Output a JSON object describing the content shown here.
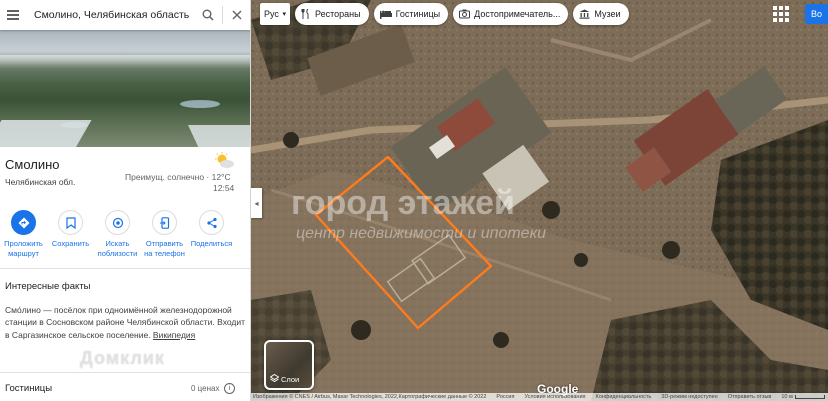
{
  "search": {
    "value": "Смолино, Челябинская область"
  },
  "place": {
    "title": "Смолино",
    "subtitle": "Челябинская обл.",
    "weather": "Преимущ. солнечно · 12°C",
    "time": "12:54"
  },
  "actions": [
    {
      "label_line1": "Проложить",
      "label_line2": "маршрут",
      "icon": "directions-icon"
    },
    {
      "label_line1": "Сохранить",
      "label_line2": "",
      "icon": "bookmark-icon"
    },
    {
      "label_line1": "Искать",
      "label_line2": "поблизости",
      "icon": "nearby-icon"
    },
    {
      "label_line1": "Отправить",
      "label_line2": "на телефон",
      "icon": "send-to-phone-icon"
    },
    {
      "label_line1": "Поделиться",
      "label_line2": "",
      "icon": "share-icon"
    }
  ],
  "facts": {
    "title": "Интересные факты",
    "text": "Смо́лино — посёлок при одноимённой железнодорожной станции в Сосновском районе Челябинской области. Входит в Саргазинское сельское поселение.",
    "link": "Википедия"
  },
  "watermark_domclick": "Домклик",
  "hotels": {
    "title": "Гостиницы",
    "price": "0 ценах"
  },
  "map": {
    "lang": "Рус",
    "chips": [
      {
        "label": "Рестораны",
        "icon": "fork-knife-icon"
      },
      {
        "label": "Гостиницы",
        "icon": "bed-icon"
      },
      {
        "label": "Достопримечатель...",
        "icon": "camera-icon"
      },
      {
        "label": "Музеи",
        "icon": "museum-icon"
      }
    ],
    "signin": "Во",
    "watermark_title": "город этажей",
    "watermark_sub": "центр недвижимости и ипотеки",
    "layers_label": "Слои",
    "google": "Google",
    "attribution": "Изображения © CNES / Airbus, Maxar Technologies, 2022,Картографические данные © 2022",
    "russia": "Россия",
    "terms": "Условия использования",
    "privacy": "Конфиденциальность",
    "mode3d": "3D-режим недоступен",
    "feedback": "Отправить отзыв",
    "scale": "10 м"
  },
  "colors": {
    "accent": "#1a73e8",
    "plot_outline": "#ff7b1c"
  }
}
